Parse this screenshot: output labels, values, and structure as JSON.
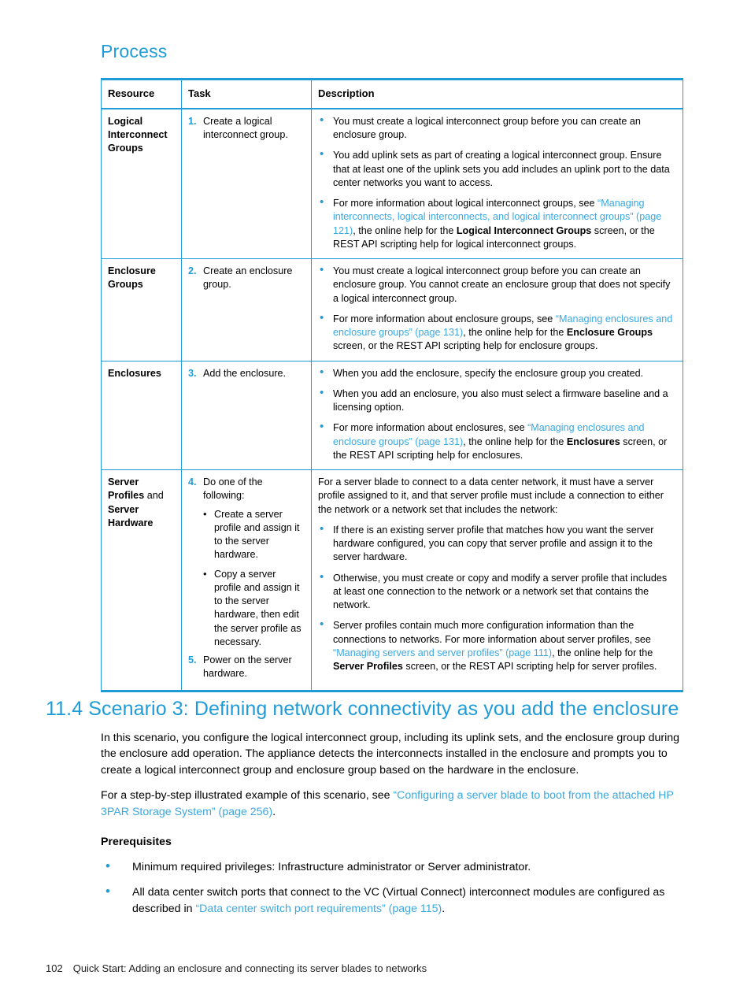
{
  "colors": {
    "accent": "#1f9cd8",
    "link": "#3aa8e0",
    "text": "#000000",
    "border": "#1f9cd8"
  },
  "process": {
    "heading": "Process"
  },
  "table": {
    "headers": {
      "resource": "Resource",
      "task": "Task",
      "description": "Description"
    },
    "rows": [
      {
        "resource_line1": "Logical",
        "resource_line2": "Interconnect",
        "resource_line3": "Groups",
        "step_number": "1.",
        "step_text": "Create a logical interconnect group.",
        "bullets": {
          "b1": "You must create a logical interconnect group before you can create an enclosure group.",
          "b2": "You add uplink sets as part of creating a logical interconnect group. Ensure that at least one of the uplink sets you add includes an uplink port to the data center networks you want to access.",
          "b3_pre": "For more information about logical interconnect groups, see ",
          "b3_link": "“Managing interconnects, logical interconnects, and logical interconnect groups” (page 121)",
          "b3_mid": ", the online help for the ",
          "b3_bold": "Logical Interconnect Groups",
          "b3_post": " screen, or the REST API scripting help for logical interconnect groups."
        }
      },
      {
        "resource_line1": "Enclosure",
        "resource_line2": "Groups",
        "step_number": "2.",
        "step_text": "Create an enclosure group.",
        "bullets": {
          "b1": "You must create a logical interconnect group before you can create an enclosure group. You cannot create an enclosure group that does not specify a logical interconnect group.",
          "b2_pre": "For more information about enclosure groups, see ",
          "b2_link": "“Managing enclosures and enclosure groups” (page 131)",
          "b2_mid": ", the online help for the ",
          "b2_bold": "Enclosure Groups",
          "b2_post": " screen, or the REST API scripting help for enclosure groups."
        }
      },
      {
        "resource_line1": "Enclosures",
        "step_number": "3.",
        "step_text": "Add the enclosure.",
        "bullets": {
          "b1": "When you add the enclosure, specify the enclosure group you created.",
          "b2": "When you add an enclosure, you also must select a firmware baseline and a licensing option.",
          "b3_pre": "For more information about enclosures, see ",
          "b3_link": "“Managing enclosures and enclosure groups” (page 131)",
          "b3_mid": ", the online help for the ",
          "b3_bold": "Enclosures",
          "b3_post": " screen, or the REST API scripting help for enclosures."
        }
      },
      {
        "resource_bold1": "Server Profiles",
        "resource_reg": " and ",
        "resource_bold2": "Server Hardware",
        "step_number": "4.",
        "step_text": "Do one of the following:",
        "sub_bullets": [
          "Create a server profile and assign it to the server hardware.",
          "Copy a server profile and assign it to the server hardware, then edit the server profile as necessary."
        ],
        "step2_number": "5.",
        "step2_text": "Power on the server hardware.",
        "desc_intro": "For a server blade to connect to a data center network, it must have a server profile assigned to it, and that server profile must include a connection to either the network or a network set that includes the network:",
        "bullets": {
          "b1": "If there is an existing server profile that matches how you want the server hardware configured, you can copy that server profile and assign it to the server hardware.",
          "b2": "Otherwise, you must create or copy and modify a server profile that includes at least one connection to the network or a network set that contains the network.",
          "b3_pre": "Server profiles contain much more configuration information than the connections to networks. For more information about server profiles, see ",
          "b3_link": "“Managing servers and server profiles” (page 111)",
          "b3_mid": ", the online help for the ",
          "b3_bold": "Server Profiles",
          "b3_post": " screen, or the REST API scripting help for server profiles."
        }
      }
    ]
  },
  "section": {
    "heading": "11.4 Scenario 3: Defining network connectivity as you add the enclosure",
    "para1": "In this scenario, you configure the logical interconnect group, including its uplink sets, and the enclosure group during the enclosure add operation. The appliance detects the interconnects installed in the enclosure and prompts you to create a logical interconnect group and enclosure group based on the hardware in the enclosure.",
    "para2_pre": "For a step-by-step illustrated example of this scenario, see ",
    "para2_link": "“Configuring a server blade to boot from the attached HP 3PAR Storage System” (page 256)",
    "para2_post": ".",
    "prereq_title": "Prerequisites",
    "prereq_items": [
      {
        "text": "Minimum required privileges: Infrastructure administrator or Server administrator."
      },
      {
        "pre": "All data center switch ports that connect to the VC (Virtual Connect) interconnect modules are configured as described in ",
        "link": "“Data center switch port requirements” (page 115)",
        "post": "."
      }
    ]
  },
  "footer": {
    "page_number": "102",
    "text": "Quick Start: Adding an enclosure and connecting its server blades to networks"
  }
}
